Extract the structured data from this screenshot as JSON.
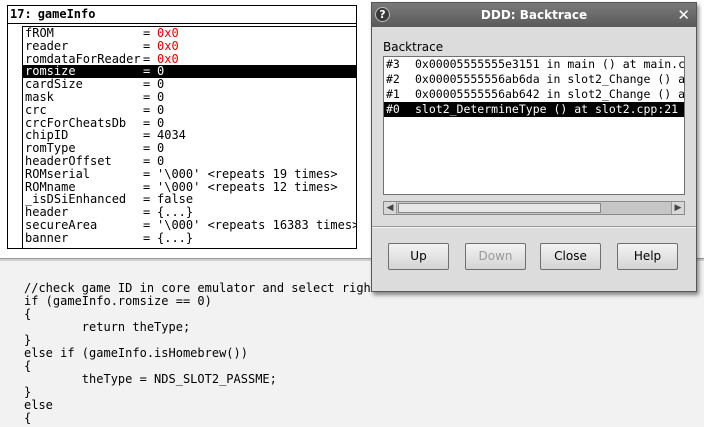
{
  "display": {
    "number": "17:",
    "name": "gameInfo",
    "fields": [
      {
        "name": "fROM",
        "value": "0x0",
        "changed": true
      },
      {
        "name": "reader",
        "value": "0x0",
        "changed": true
      },
      {
        "name": "romdataForReader",
        "value": "0x0",
        "changed": true
      },
      {
        "name": "romsize",
        "value": "0",
        "selected": true
      },
      {
        "name": "cardSize",
        "value": "0"
      },
      {
        "name": "mask",
        "value": "0"
      },
      {
        "name": "crc",
        "value": "0"
      },
      {
        "name": "crcForCheatsDb",
        "value": "0"
      },
      {
        "name": "chipID",
        "value": "4034"
      },
      {
        "name": "romType",
        "value": "0"
      },
      {
        "name": "headerOffset",
        "value": "0"
      },
      {
        "name": "ROMserial",
        "value": "'\\000' <repeats 19 times>"
      },
      {
        "name": "ROMname",
        "value": "'\\000' <repeats 12 times>"
      },
      {
        "name": "_isDSiEnhanced",
        "value": "false"
      },
      {
        "name": "header",
        "value": "{...}"
      },
      {
        "name": "secureArea",
        "value": "'\\000' <repeats 16383 times>"
      },
      {
        "name": "banner",
        "value": "{...}"
      }
    ]
  },
  "source": {
    "lines": [
      "//check game ID in core emulator and select right",
      "if (gameInfo.romsize == 0)",
      "{",
      "        return theType;",
      "}",
      "else if (gameInfo.isHomebrew())",
      "{",
      "        theType = NDS_SLOT2_PASSME;",
      "}",
      "else",
      "{"
    ]
  },
  "dialog": {
    "title": "DDD: Backtrace",
    "icon": "question-icon",
    "close_glyph": "✕",
    "list_label": "Backtrace",
    "frames": [
      {
        "num": "#3",
        "text": "0x00005555555e3151 in main () at main.c"
      },
      {
        "num": "#2",
        "text": "0x00005555556ab6da in slot2_Change () a"
      },
      {
        "num": "#1",
        "text": "0x00005555556ab642 in slot2_Change () a"
      },
      {
        "num": "#0",
        "text": "slot2_DetermineType () at slot2.cpp:21",
        "selected": true
      }
    ],
    "buttons": {
      "up": "Up",
      "down": "Down",
      "close": "Close",
      "help": "Help"
    }
  },
  "colors": {
    "changed_value": "#e00000",
    "selection": "#000000"
  }
}
